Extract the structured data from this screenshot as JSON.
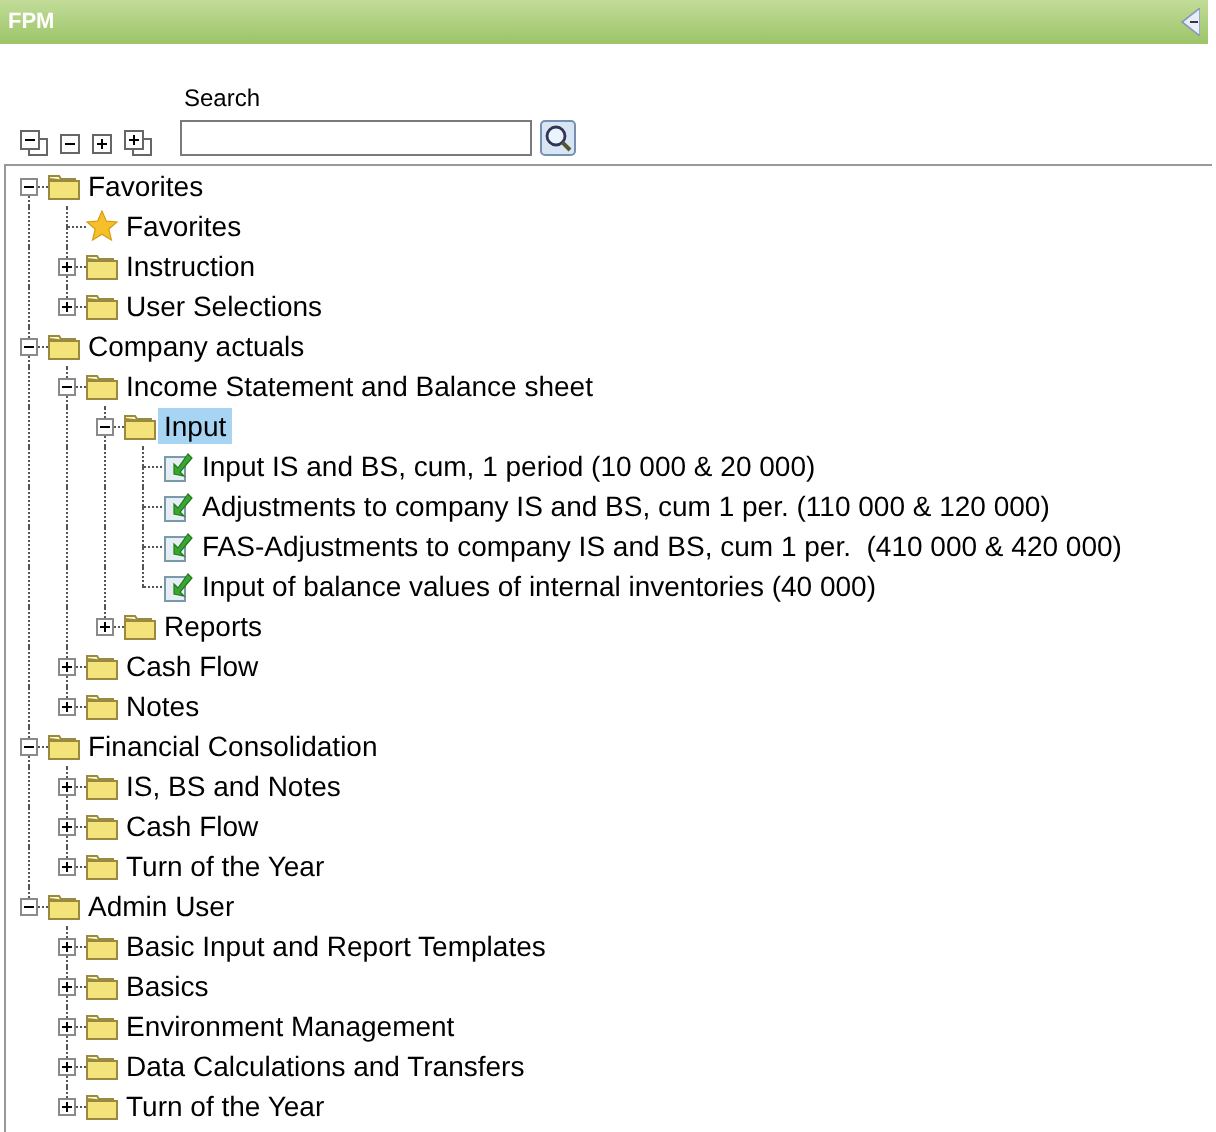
{
  "header": {
    "title": "FPM"
  },
  "toolbar": {
    "search_label": "Search"
  },
  "tree": [
    {
      "label": "Favorites",
      "kind": "folder",
      "expanded": true,
      "selected": false,
      "children": [
        {
          "label": "Favorites",
          "kind": "star",
          "selected": false
        },
        {
          "label": "Instruction",
          "kind": "folder",
          "expanded": false,
          "selected": false
        },
        {
          "label": "User Selections",
          "kind": "folder",
          "expanded": false,
          "selected": false
        }
      ]
    },
    {
      "label": "Company actuals",
      "kind": "folder",
      "expanded": true,
      "selected": false,
      "children": [
        {
          "label": "Income Statement and Balance sheet",
          "kind": "folder",
          "expanded": true,
          "selected": false,
          "children": [
            {
              "label": "Input",
              "kind": "folder",
              "expanded": true,
              "selected": true,
              "children": [
                {
                  "label": "Input IS and BS, cum, 1 period (10 000 & 20 000)",
                  "kind": "form",
                  "selected": false
                },
                {
                  "label": "Adjustments to company IS and BS, cum 1 per. (110 000 & 120 000)",
                  "kind": "form",
                  "selected": false
                },
                {
                  "label": "FAS-Adjustments to company IS and BS, cum 1 per.  (410 000 & 420 000)",
                  "kind": "form",
                  "selected": false
                },
                {
                  "label": "Input of balance values of internal inventories (40 000)",
                  "kind": "form",
                  "selected": false
                }
              ]
            },
            {
              "label": "Reports",
              "kind": "folder",
              "expanded": false,
              "selected": false
            }
          ]
        },
        {
          "label": "Cash Flow",
          "kind": "folder",
          "expanded": false,
          "selected": false
        },
        {
          "label": "Notes",
          "kind": "folder",
          "expanded": false,
          "selected": false
        }
      ]
    },
    {
      "label": "Financial Consolidation",
      "kind": "folder",
      "expanded": true,
      "selected": false,
      "children": [
        {
          "label": "IS, BS and Notes",
          "kind": "folder",
          "expanded": false,
          "selected": false
        },
        {
          "label": "Cash Flow",
          "kind": "folder",
          "expanded": false,
          "selected": false
        },
        {
          "label": "Turn of the Year",
          "kind": "folder",
          "expanded": false,
          "selected": false
        }
      ]
    },
    {
      "label": "Admin User",
      "kind": "folder",
      "expanded": true,
      "selected": false,
      "children": [
        {
          "label": "Basic Input and Report Templates",
          "kind": "folder",
          "expanded": false,
          "selected": false
        },
        {
          "label": "Basics",
          "kind": "folder",
          "expanded": false,
          "selected": false
        },
        {
          "label": "Environment Management",
          "kind": "folder",
          "expanded": false,
          "selected": false
        },
        {
          "label": "Data Calculations and Transfers",
          "kind": "folder",
          "expanded": false,
          "selected": false
        },
        {
          "label": "Turn of the Year",
          "kind": "folder",
          "expanded": false,
          "selected": false
        }
      ]
    }
  ]
}
